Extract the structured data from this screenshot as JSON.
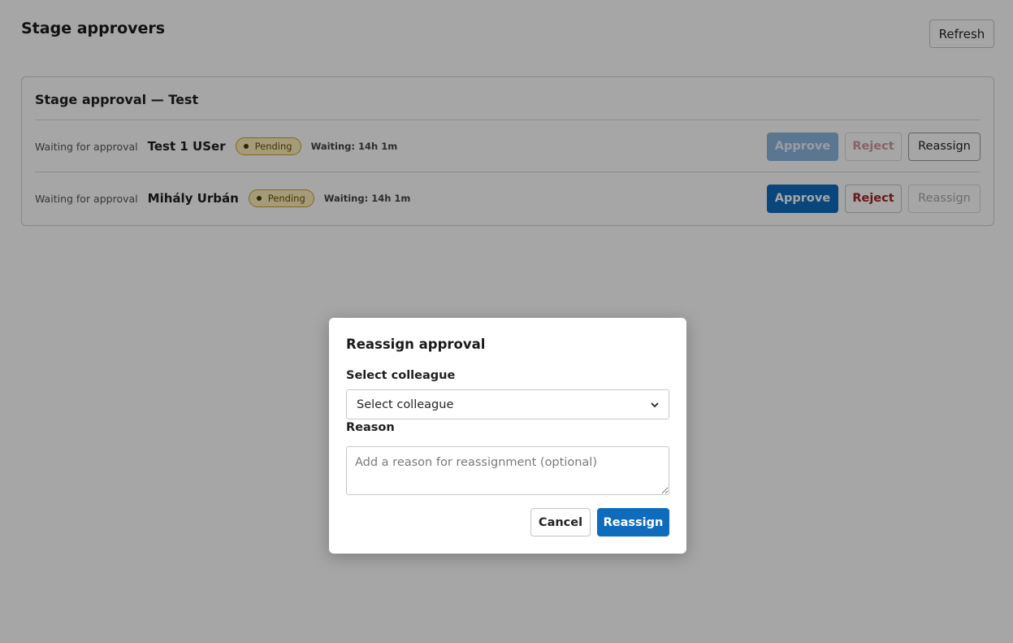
{
  "header": {
    "title": "Stage approvers",
    "refresh_label": "Refresh"
  },
  "card": {
    "title": "Stage approval — Test",
    "rows": [
      {
        "status_label": "Waiting for approval",
        "user_name": "Test 1 USer",
        "badge": "Pending",
        "waiting": "Waiting: 14h 1m",
        "approve_label": "Approve",
        "reject_label": "Reject",
        "reassign_label": "Reassign"
      },
      {
        "status_label": "Waiting for approval",
        "user_name": "Mihály Urbán",
        "badge": "Pending",
        "waiting": "Waiting: 14h 1m",
        "approve_label": "Approve",
        "reject_label": "Reject",
        "reassign_label": "Reassign"
      }
    ]
  },
  "dialog": {
    "title": "Reassign approval",
    "colleague_label": "Select colleague",
    "colleague_selected": "Select colleague",
    "reason_label": "Reason",
    "reason_placeholder": "Add a reason for reassignment (optional)",
    "cancel_label": "Cancel",
    "confirm_label": "Reassign"
  },
  "colors": {
    "primary": "#0f6cbd",
    "reject": "#a4262c",
    "badge_bg": "#fbeebc",
    "badge_border": "#c9a227"
  },
  "icons": {
    "select": "chevron-down-icon",
    "badge": "dot-icon"
  }
}
